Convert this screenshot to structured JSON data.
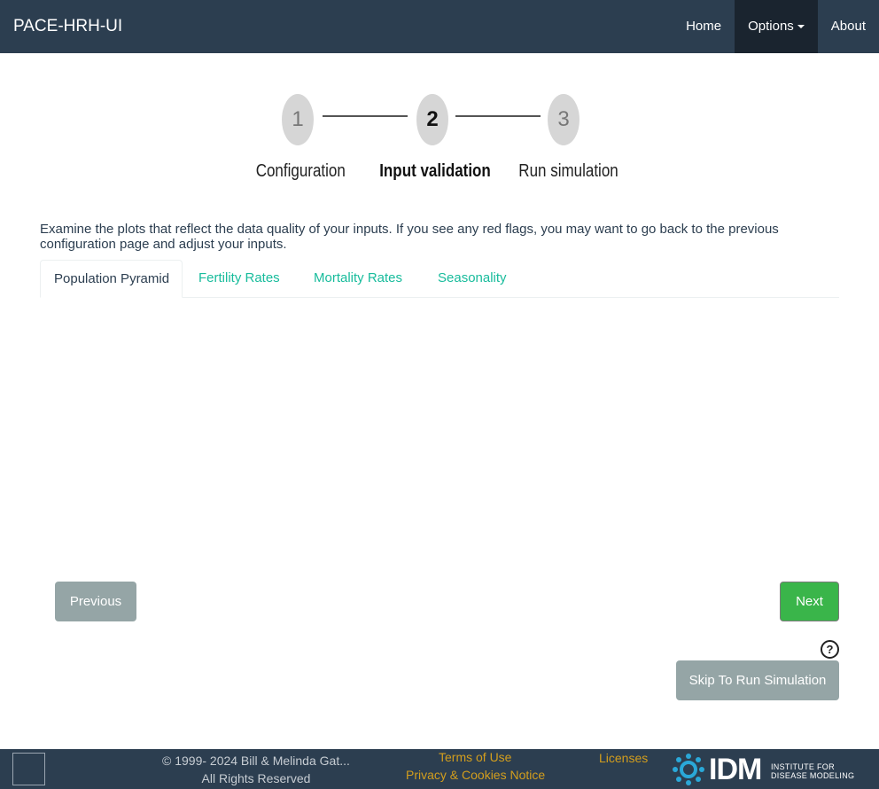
{
  "navbar": {
    "brand": "PACE-HRH-UI",
    "items": [
      {
        "label": "Home"
      },
      {
        "label": "Options"
      },
      {
        "label": "About"
      }
    ]
  },
  "stepper": {
    "steps": [
      {
        "number": "1",
        "label": "Configuration"
      },
      {
        "number": "2",
        "label": "Input validation"
      },
      {
        "number": "3",
        "label": "Run simulation"
      }
    ],
    "active_step": 2
  },
  "intro_text": "Examine the plots that reflect the data quality of your inputs. If you see any red flags, you may want to go back to the previous configuration page and adjust your inputs.",
  "tabs": [
    {
      "label": "Population Pyramid",
      "active": true
    },
    {
      "label": "Fertility Rates",
      "active": false
    },
    {
      "label": "Mortality Rates",
      "active": false
    },
    {
      "label": "Seasonality",
      "active": false
    }
  ],
  "buttons": {
    "previous": "Previous",
    "next": "Next",
    "help": "?",
    "skip": "Skip To Run Simulation"
  },
  "footer": {
    "copyright_line1": "© 1999- 2024 Bill & Melinda Gat...",
    "copyright_line2": "All Rights Reserved",
    "terms": "Terms of Use",
    "privacy": "Privacy & Cookies Notice",
    "licenses": "Licenses",
    "logo_text": "IDM",
    "logo_sub_line1": "INSTITUTE FOR",
    "logo_sub_line2": "DISEASE MODELING"
  },
  "colors": {
    "navbar": "#2c3e50",
    "tab_link": "#18bc9c",
    "next_button": "#3ab54a",
    "secondary_button": "#95a5a6",
    "footer_link": "#d39e1d"
  }
}
